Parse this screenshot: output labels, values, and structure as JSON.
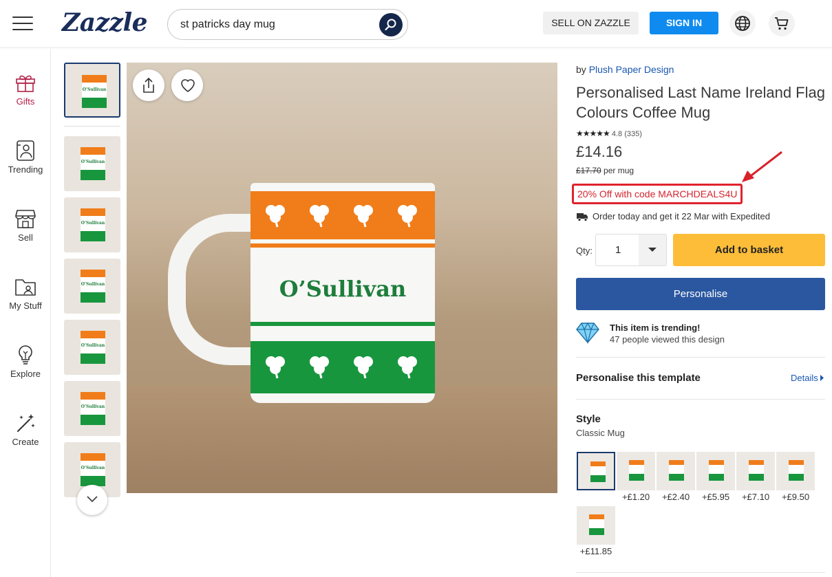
{
  "header": {
    "logo": "Zazzle",
    "search_value": "st patricks day mug",
    "sell_label": "SELL ON ZAZZLE",
    "signin_label": "SIGN IN"
  },
  "sidebar": {
    "items": [
      {
        "label": "Gifts"
      },
      {
        "label": "Trending"
      },
      {
        "label": "Sell"
      },
      {
        "label": "My Stuff"
      },
      {
        "label": "Explore"
      },
      {
        "label": "Create"
      }
    ]
  },
  "product": {
    "image_name": "O’Sullivan",
    "thumb_name": "O’Sullivan",
    "by_prefix": "by",
    "designer": "Plush Paper Design",
    "title": "Personalised Last Name Ireland Flag Colours Coffee Mug",
    "stars": "★★★★★",
    "rating": "4.8",
    "reviews": "(335)",
    "price": "£14.16",
    "old_price": "£17.70",
    "per_unit": "per mug",
    "promo": "20% Off with code MARCHDEALS4U",
    "delivery": "Order today and get it 22 Mar with Expedited",
    "qty_label": "Qty:",
    "qty_value": "1",
    "add_label": "Add to basket",
    "personalise_label": "Personalise",
    "trend_title": "This item is trending!",
    "trend_text": "47 people viewed this design",
    "template_title": "Personalise this template",
    "details_label": "Details",
    "style_title": "Style",
    "style_value": "Classic Mug",
    "style_options": [
      {
        "price": ""
      },
      {
        "price": "+£1.20"
      },
      {
        "price": "+£2.40"
      },
      {
        "price": "+£5.95"
      },
      {
        "price": "+£7.10"
      },
      {
        "price": "+£9.50"
      },
      {
        "price": "+£11.85"
      }
    ]
  },
  "colors": {
    "brand_navy": "#1a2d5a",
    "signin_blue": "#0f8bef",
    "add_yellow": "#fdbd39",
    "personalise_blue": "#2a57a0",
    "promo_red": "#e0232d",
    "gifts_active": "#b11f46"
  },
  "icons": [
    "hamburger-icon",
    "search-icon",
    "globe-icon",
    "cart-icon",
    "gift-icon",
    "trending-icon",
    "store-icon",
    "folder-icon",
    "bulb-icon",
    "create-icon",
    "share-icon",
    "heart-icon",
    "chevron-down-icon",
    "truck-icon",
    "diamond-icon",
    "chevron-right-icon"
  ]
}
